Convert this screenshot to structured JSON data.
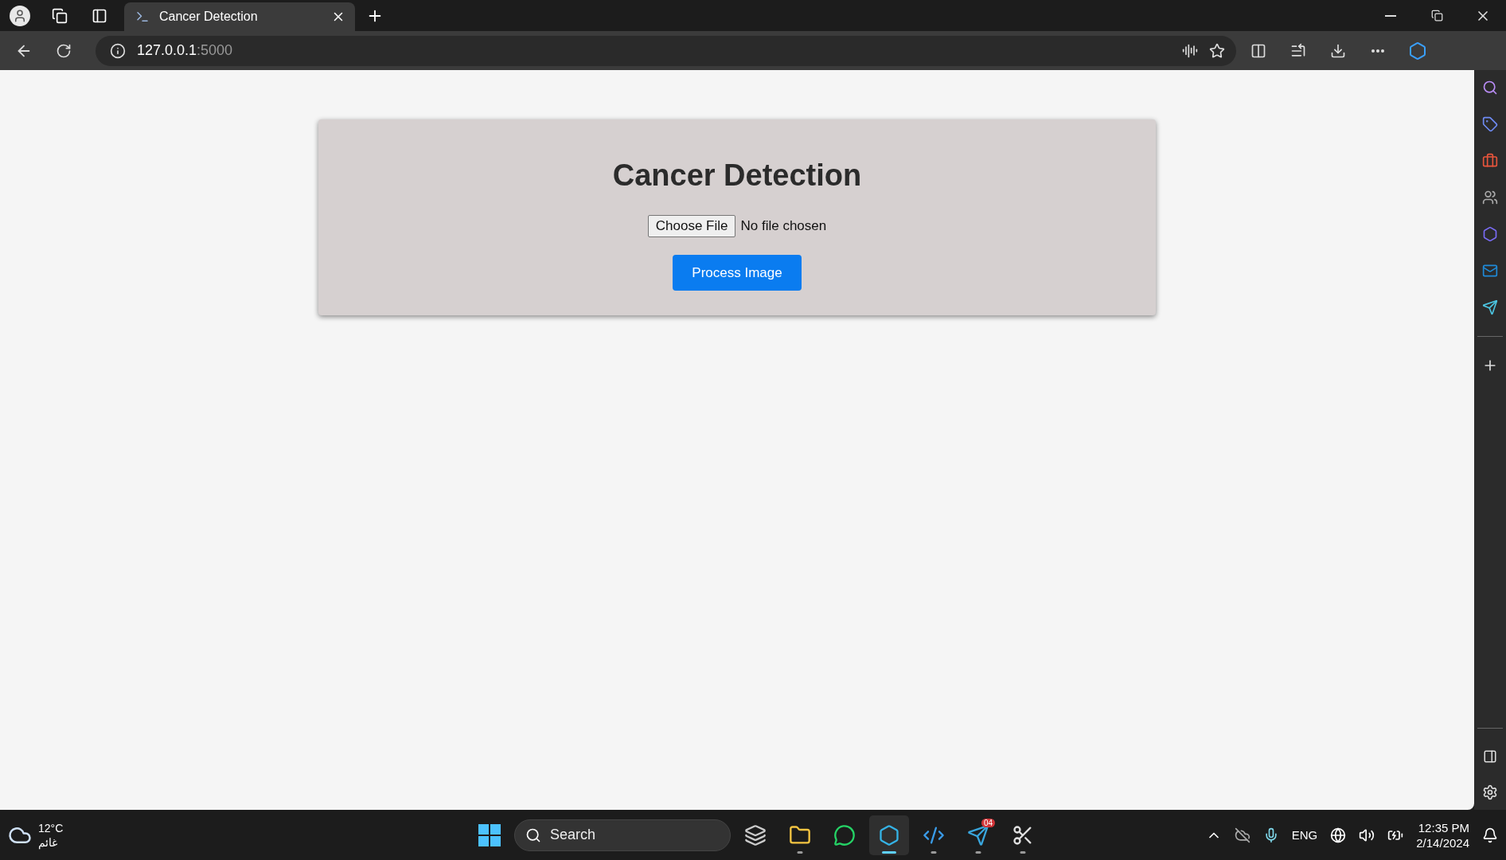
{
  "browser": {
    "tabs": [
      {
        "title": "Cancer Detection",
        "selected": true
      }
    ],
    "address": {
      "host": "127.0.0.1",
      "port": ":5000"
    }
  },
  "page": {
    "title": "Cancer Detection",
    "file_input": {
      "button": "Choose File",
      "status": "No file chosen"
    },
    "submit": "Process Image"
  },
  "taskbar": {
    "weather": {
      "temperature": "12°C",
      "condition": "غائم"
    },
    "search": {
      "placeholder": "Search"
    },
    "apps": [
      {
        "kind": "taskview",
        "active": false,
        "running": false
      },
      {
        "kind": "explorer",
        "active": false,
        "running": true
      },
      {
        "kind": "whatsapp",
        "active": false,
        "running": false
      },
      {
        "kind": "edge",
        "active": true,
        "running": true
      },
      {
        "kind": "vscode",
        "active": false,
        "running": true
      },
      {
        "kind": "telegram",
        "active": false,
        "running": true,
        "badge": "04"
      },
      {
        "kind": "snipping",
        "active": false,
        "running": true
      }
    ],
    "language": "ENG",
    "time": "12:35 PM",
    "date": "2/14/2024"
  }
}
